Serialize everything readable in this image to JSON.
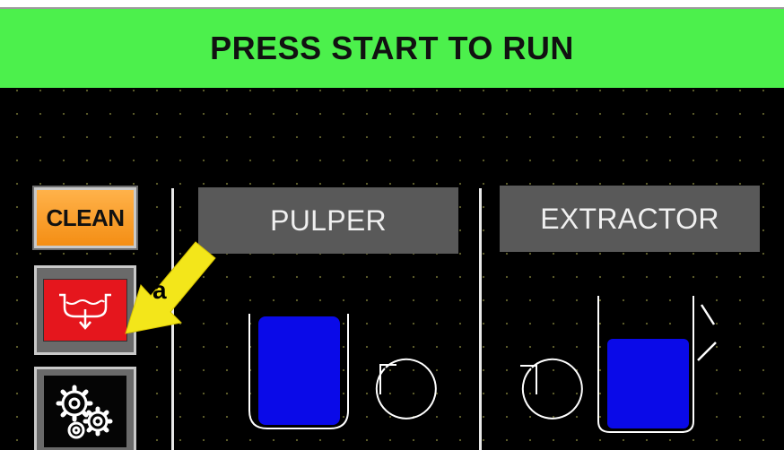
{
  "status_banner": {
    "text": "PRESS START TO RUN",
    "color": "#4cf04c"
  },
  "side_buttons": {
    "clean_label": "CLEAN",
    "drain_icon": "drain-icon",
    "settings_icon": "gears-icon"
  },
  "stations": [
    {
      "label": "PULPER",
      "tank_fill": 0.95
    },
    {
      "label": "EXTRACTOR",
      "tank_fill": 0.6
    }
  ],
  "annotation": {
    "letter": "a"
  },
  "colors": {
    "tank_fill": "#0a0ae8",
    "clean_button": "#f59a22",
    "drain_button": "#e5161d",
    "arrow": "#f3e61a"
  }
}
